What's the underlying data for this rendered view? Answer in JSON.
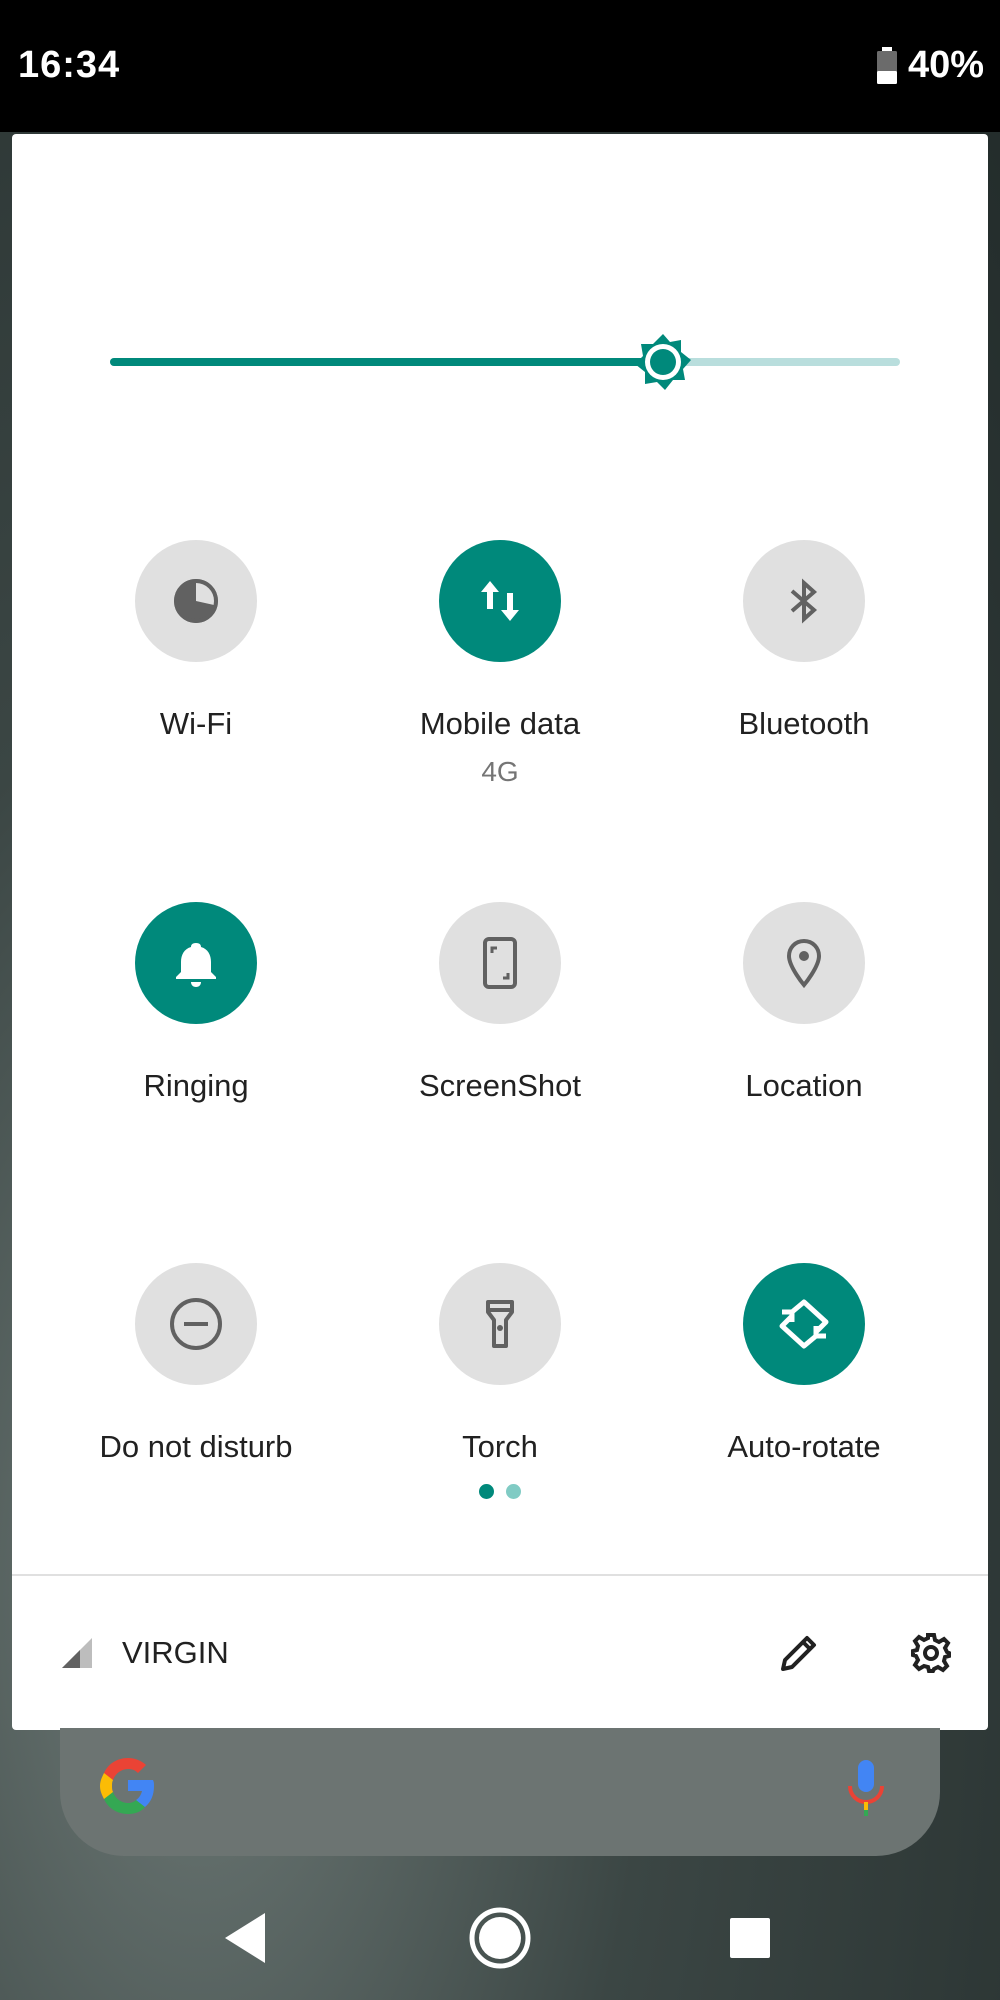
{
  "status_bar": {
    "time": "16:34",
    "battery": "40%",
    "battery_level": 0.4
  },
  "brightness": {
    "level": 0.7
  },
  "tiles": [
    {
      "label": "Wi-Fi",
      "sub": "",
      "active": false,
      "icon": "wifi-off-icon"
    },
    {
      "label": "Mobile data",
      "sub": "4G",
      "active": true,
      "icon": "mobile-data-icon"
    },
    {
      "label": "Bluetooth",
      "sub": "",
      "active": false,
      "icon": "bluetooth-icon"
    },
    {
      "label": "Ringing",
      "sub": "",
      "active": true,
      "icon": "bell-icon"
    },
    {
      "label": "ScreenShot",
      "sub": "",
      "active": false,
      "icon": "screenshot-icon"
    },
    {
      "label": "Location",
      "sub": "",
      "active": false,
      "icon": "location-pin-icon"
    },
    {
      "label": "Do not disturb",
      "sub": "",
      "active": false,
      "icon": "do-not-disturb-icon"
    },
    {
      "label": "Torch",
      "sub": "",
      "active": false,
      "icon": "flashlight-icon"
    },
    {
      "label": "Auto-rotate",
      "sub": "",
      "active": true,
      "icon": "auto-rotate-icon"
    }
  ],
  "page_indicator": {
    "pages": 2,
    "current": 0
  },
  "footer": {
    "carrier": "VIRGIN"
  },
  "colors": {
    "accent": "#00897b",
    "accent_light": "#b9dedd",
    "tile_inactive": "#e0e0e0",
    "icon_inactive": "#616161"
  }
}
